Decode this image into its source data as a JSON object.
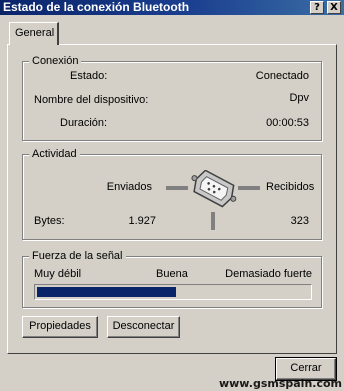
{
  "window": {
    "title": "Estado de la conexión Bluetooth",
    "help_label": "?",
    "close_label": "X"
  },
  "tabs": [
    {
      "label": "General",
      "selected": true
    }
  ],
  "connection": {
    "legend": "Conexión",
    "status_label": "Estado:",
    "status_value": "Conectado",
    "device_label": "Nombre del dispositivo:",
    "device_value": "Dpv",
    "duration_label": "Duración:",
    "duration_value": "00:00:53"
  },
  "activity": {
    "legend": "Actividad",
    "sent_label": "Enviados",
    "received_label": "Recibidos",
    "bytes_label": "Bytes:",
    "bytes_sent": "1.927",
    "bytes_received": "323",
    "icon": "serial-connector-icon"
  },
  "signal": {
    "legend": "Fuerza de la señal",
    "low_label": "Muy débil",
    "mid_label": "Buena",
    "high_label": "Demasiado fuerte",
    "strength_fraction": 0.51,
    "bar_color": "#0a246a"
  },
  "buttons": {
    "properties": "Propiedades",
    "disconnect": "Desconectar",
    "close": "Cerrar"
  },
  "watermark": "www.gsmspain.com"
}
